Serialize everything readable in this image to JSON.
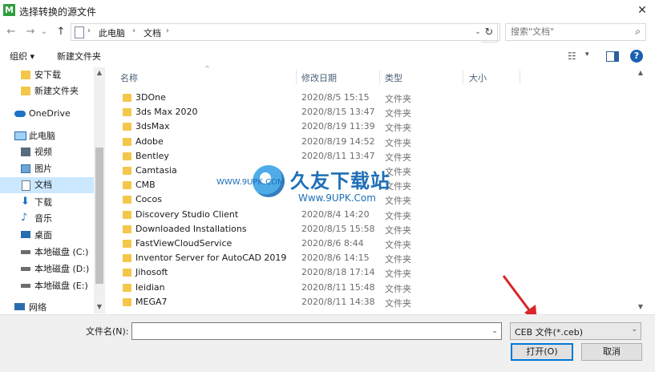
{
  "window": {
    "app_icon_letter": "M",
    "title": "选择转换的源文件",
    "close": "✕"
  },
  "nav": {
    "back": "←",
    "forward": "→",
    "recent": "⌄",
    "up": "↑",
    "breadcrumb": [
      "此电脑",
      "文档"
    ],
    "separator": "›",
    "dropdown": "⌄",
    "refresh": "↻",
    "search_placeholder": "搜索\"文档\"",
    "search_icon": "⌕"
  },
  "toolbar": {
    "organize": "组织 ▾",
    "new_folder": "新建文件夹",
    "view_icon": "☷",
    "view_dropdown": "▾",
    "help": "?"
  },
  "sidebar": {
    "items": [
      {
        "label": "安下载",
        "icon": "folder-icon"
      },
      {
        "label": "新建文件夹",
        "icon": "folder-icon"
      },
      {
        "label": "OneDrive",
        "icon": "cloud-icon"
      },
      {
        "label": "此电脑",
        "icon": "computer-icon"
      },
      {
        "label": "视频",
        "icon": "video-icon"
      },
      {
        "label": "图片",
        "icon": "picture-icon"
      },
      {
        "label": "文档",
        "icon": "document-icon"
      },
      {
        "label": "下载",
        "icon": "download-icon"
      },
      {
        "label": "音乐",
        "icon": "music-icon"
      },
      {
        "label": "桌面",
        "icon": "desktop-icon"
      },
      {
        "label": "本地磁盘 (C:)",
        "icon": "drive-icon"
      },
      {
        "label": "本地磁盘 (D:)",
        "icon": "drive-icon"
      },
      {
        "label": "本地磁盘 (E:)",
        "icon": "drive-icon"
      },
      {
        "label": "网络",
        "icon": "network-icon"
      }
    ],
    "scroll_up": "▲",
    "scroll_down": "▼"
  },
  "columns": {
    "name": "名称",
    "modified": "修改日期",
    "type": "类型",
    "size": "大小",
    "sort_indicator": "^"
  },
  "files": [
    {
      "name": "3DOne",
      "date": "2020/8/5 15:15",
      "type": "文件夹"
    },
    {
      "name": "3ds Max 2020",
      "date": "2020/8/15 13:47",
      "type": "文件夹"
    },
    {
      "name": "3dsMax",
      "date": "2020/8/19 11:39",
      "type": "文件夹"
    },
    {
      "name": "Adobe",
      "date": "2020/8/19 14:52",
      "type": "文件夹"
    },
    {
      "name": "Bentley",
      "date": "2020/8/11 13:47",
      "type": "文件夹"
    },
    {
      "name": "Camtasia",
      "date": "",
      "type": "文件夹"
    },
    {
      "name": "CMB",
      "date": "",
      "type": "文件夹"
    },
    {
      "name": "Cocos",
      "date": "",
      "type": "文件夹"
    },
    {
      "name": "Discovery Studio Client",
      "date": "2020/8/4 14:20",
      "type": "文件夹"
    },
    {
      "name": "Downloaded Installations",
      "date": "2020/8/15 15:58",
      "type": "文件夹"
    },
    {
      "name": "FastViewCloudService",
      "date": "2020/8/6 8:44",
      "type": "文件夹"
    },
    {
      "name": "Inventor Server for AutoCAD 2019",
      "date": "2020/8/6 14:15",
      "type": "文件夹"
    },
    {
      "name": "Jihosoft",
      "date": "2020/8/18 17:14",
      "type": "文件夹"
    },
    {
      "name": "leidian",
      "date": "2020/8/11 15:48",
      "type": "文件夹"
    },
    {
      "name": "MEGA7",
      "date": "2020/8/11 14:38",
      "type": "文件夹"
    }
  ],
  "list_scroll": {
    "up": "▲",
    "down": "▼"
  },
  "watermark": {
    "big": "久友下载站",
    "url_small": "WWW.9UPK.COM",
    "url": "Www.9UPK.Com"
  },
  "bottom": {
    "filename_label": "文件名(N):",
    "filename_value": "",
    "filename_dropdown": "⌄",
    "filetype": "CEB 文件(*.ceb)",
    "filetype_dropdown": "⌄",
    "open": "打开(O)",
    "cancel": "取消"
  },
  "colors": {
    "accent": "#0078d7",
    "selection": "#cce8ff",
    "folder": "#f4c74b",
    "annotation_arrow": "#d9262a"
  }
}
